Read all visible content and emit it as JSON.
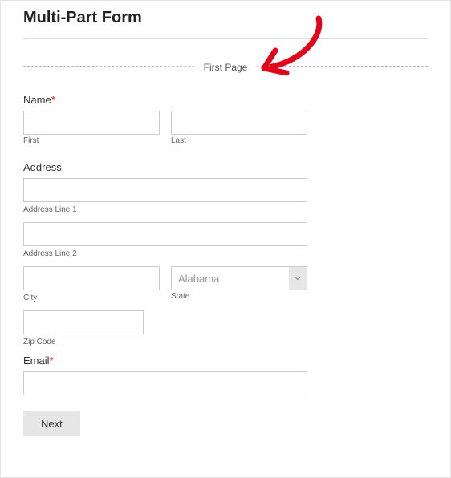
{
  "header": {
    "title": "Multi-Part Form"
  },
  "pageBreak": {
    "label": "First Page"
  },
  "name": {
    "label": "Name",
    "required": "*",
    "first": {
      "value": "",
      "sub": "First"
    },
    "last": {
      "value": "",
      "sub": "Last"
    }
  },
  "address": {
    "label": "Address",
    "line1": {
      "value": "",
      "sub": "Address Line 1"
    },
    "line2": {
      "value": "",
      "sub": "Address Line 2"
    },
    "city": {
      "value": "",
      "sub": "City"
    },
    "state": {
      "selected": "Alabama",
      "sub": "State"
    },
    "zip": {
      "value": "",
      "sub": "Zip Code"
    }
  },
  "email": {
    "label": "Email",
    "required": "*",
    "value": ""
  },
  "buttons": {
    "next": "Next"
  },
  "annotation": {
    "color": "#e2001a"
  }
}
